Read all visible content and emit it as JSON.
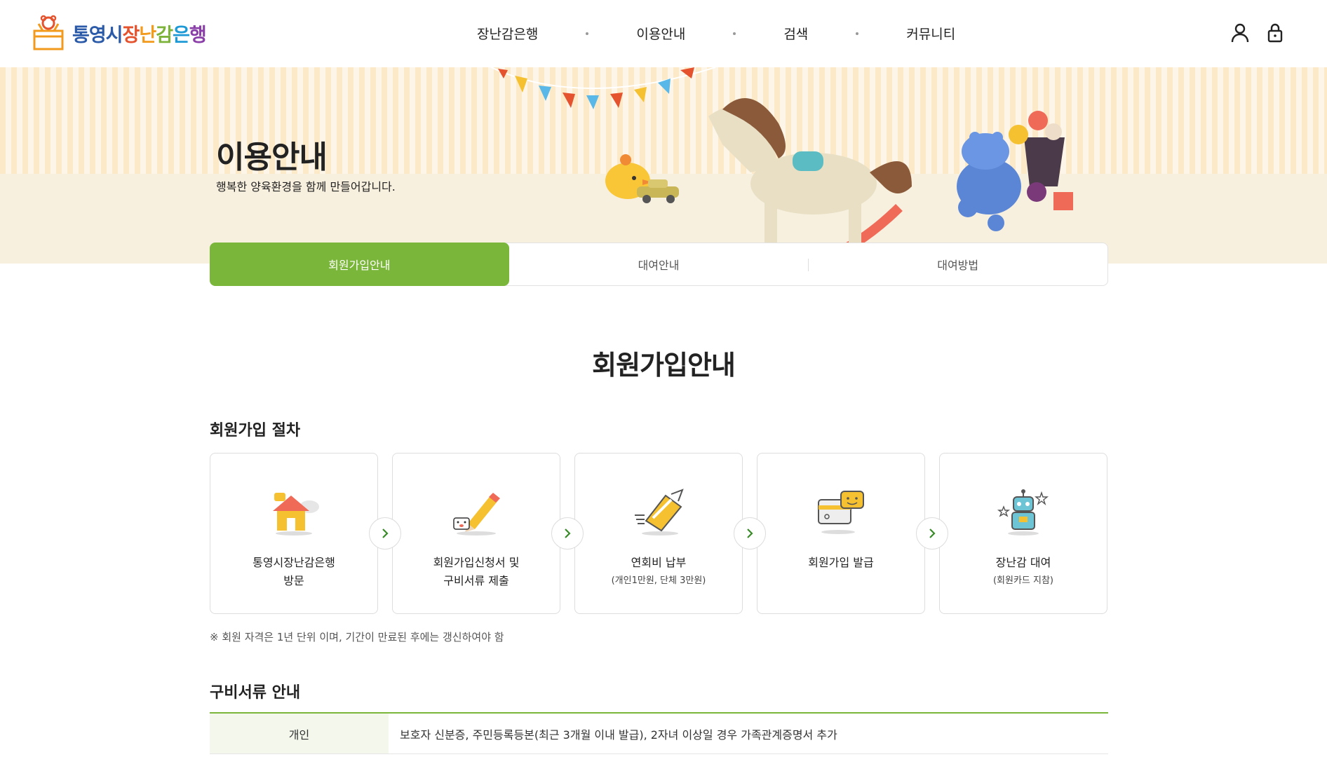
{
  "header": {
    "logo_text": [
      "통영시",
      "장",
      "난",
      "감",
      "은",
      "행"
    ],
    "nav": [
      "장난감은행",
      "이용안내",
      "검색",
      "커뮤니티"
    ]
  },
  "hero": {
    "title": "이용안내",
    "subtitle": "행복한 양육환경을 함께 만들어갑니다."
  },
  "tabs": [
    {
      "label": "회원가입안내",
      "active": true
    },
    {
      "label": "대여안내",
      "active": false
    },
    {
      "label": "대여방법",
      "active": false
    }
  ],
  "main": {
    "page_title": "회원가입안내",
    "procedure_title": "회원가입 절차",
    "steps": [
      {
        "icon": "house-icon",
        "line1": "통영시장난감은행",
        "line2": "방문"
      },
      {
        "icon": "pencil-icon",
        "line1": "회원가입신청서 및",
        "line2": "구비서류 제출"
      },
      {
        "icon": "card-payment-icon",
        "line1": "연회비 납부",
        "line2": "(개인1만원, 단체 3만원)"
      },
      {
        "icon": "member-card-icon",
        "line1": "회원가입 발급",
        "line2": ""
      },
      {
        "icon": "robot-toy-icon",
        "line1": "장난감 대여",
        "line2": "(회원카드 지참)"
      }
    ],
    "note": "※ 회원 자격은 1년 단위 이며, 기간이 만료된 후에는 갱신하여야 함",
    "docs_title": "구비서류 안내",
    "docs": [
      {
        "type": "개인",
        "desc": "보호자 신분증, 주민등록등본(최근 3개월 이내 발급), 2자녀 이상일 경우 가족관계증명서 추가"
      }
    ]
  },
  "colors": {
    "accent": "#7ab63a",
    "hero_stripe": "#fbe9c8",
    "hero_base": "#f8f0df"
  }
}
